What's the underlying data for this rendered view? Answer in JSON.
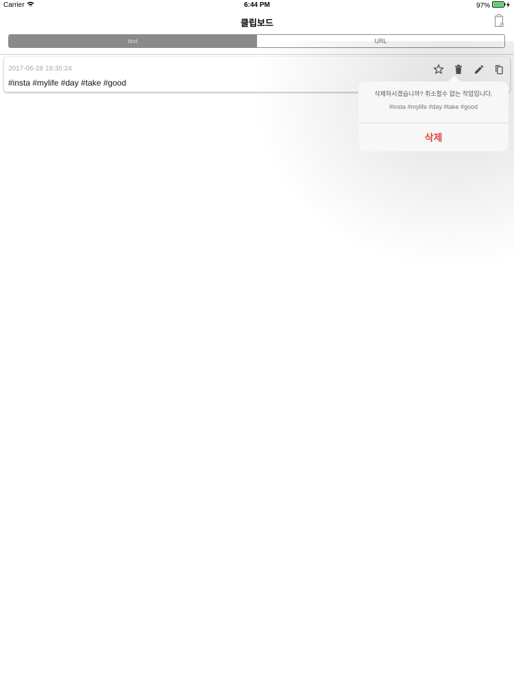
{
  "status_bar": {
    "carrier": "Carrier",
    "time": "6:44 PM",
    "battery": "97%",
    "battery_level": 0.97,
    "battery_color": "#4cd964",
    "icons": [
      "wifi-icon",
      "battery-icon",
      "bolt-icon"
    ]
  },
  "nav": {
    "title": "클립보드",
    "right_icon": "clipboard-icon"
  },
  "segmented": {
    "options": [
      "text",
      "URL"
    ],
    "selected": "text"
  },
  "card": {
    "date": "2017-06-28 18:35:24",
    "text": "#insta #mylife #day #take #good",
    "actions": [
      "star-icon",
      "trash-icon",
      "pencil-icon",
      "copy-icon"
    ]
  },
  "popover": {
    "message": "삭제하시겠습니까? 취소할수 없는 작업입니다.",
    "detail": "#insta #mylife #day #take #good",
    "delete_label": "삭제",
    "delete_color": "#e0463f"
  }
}
